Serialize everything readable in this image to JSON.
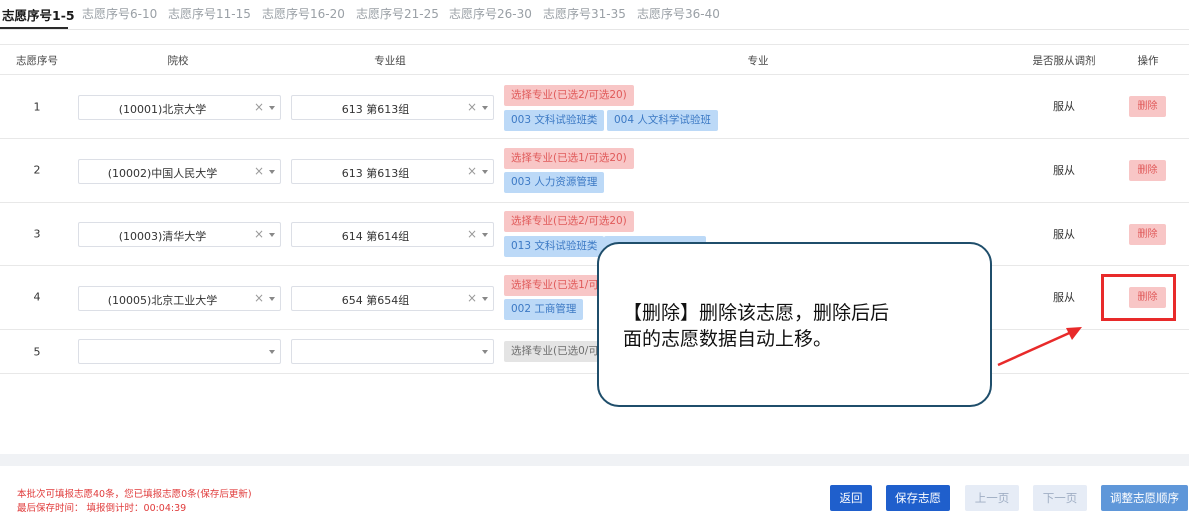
{
  "tabs": [
    "志愿序号1-5",
    "志愿序号6-10",
    "志愿序号11-15",
    "志愿序号16-20",
    "志愿序号21-25",
    "志愿序号26-30",
    "志愿序号31-35",
    "志愿序号36-40"
  ],
  "headers": {
    "seq": "志愿序号",
    "school": "院校",
    "group": "专业组",
    "major": "专业",
    "adjust": "是否服从调剂",
    "action": "操作"
  },
  "rows": [
    {
      "seq": "1",
      "school": "(10001)北京大学",
      "group": "613 第613组",
      "pick": "选择专业(已选2/可选20)",
      "majors": [
        "003 文科试验班类",
        "004 人文科学试验班"
      ],
      "adjust": "服从",
      "delete": "删除"
    },
    {
      "seq": "2",
      "school": "(10002)中国人民大学",
      "group": "613 第613组",
      "pick": "选择专业(已选1/可选20)",
      "majors": [
        "003 人力资源管理"
      ],
      "adjust": "服从",
      "delete": "删除"
    },
    {
      "seq": "3",
      "school": "(10003)清华大学",
      "group": "614 第614组",
      "pick": "选择专业(已选2/可选20)",
      "majors": [
        "013 文科试验班类"
      ],
      "adjust": "服从",
      "delete": "删除"
    },
    {
      "seq": "4",
      "school": "(10005)北京工业大学",
      "group": "654 第654组",
      "pick": "选择专业(已选1/可",
      "majors": [
        "002 工商管理"
      ],
      "adjust": "服从",
      "delete": "删除"
    },
    {
      "seq": "5",
      "school": "",
      "group": "",
      "pick": "选择专业(已选0/可",
      "majors": [],
      "adjust": "",
      "delete": ""
    }
  ],
  "callout": {
    "line1": "【删除】删除该志愿，删除后后",
    "line2": "面的志愿数据自动上移。"
  },
  "footer": {
    "info1": "本批次可填报志愿40条，您已填报志愿0条(保存后更新)",
    "info2": "最后保存时间：  填报倒计时：00:04:39",
    "buttons": {
      "back": "返回",
      "save": "保存志愿",
      "prev": "上一页",
      "next": "下一页",
      "reorder": "调整志愿顺序"
    }
  },
  "colors": {
    "primary": "#1f5fcc",
    "danger_bg": "#f8c6c6",
    "danger_text": "#e05a5a",
    "tag_bg": "#bcd9f7",
    "tag_text": "#3c79c4",
    "highlight": "#e82a2a"
  },
  "icons": {
    "clear": "clear-x-icon",
    "caret": "caret-down-icon",
    "arrow": "annotation-arrow"
  }
}
